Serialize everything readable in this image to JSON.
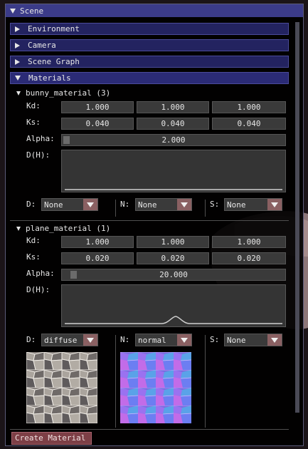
{
  "window": {
    "title": "Scene"
  },
  "sections": [
    {
      "label": "Environment",
      "open": false
    },
    {
      "label": "Camera",
      "open": false
    },
    {
      "label": "Scene Graph",
      "open": false
    },
    {
      "label": "Materials",
      "open": true
    }
  ],
  "materials": [
    {
      "name": "bunny_material (3)",
      "kd_label": "Kd:",
      "kd": [
        "1.000",
        "1.000",
        "1.000"
      ],
      "ks_label": "Ks:",
      "ks": [
        "0.040",
        "0.040",
        "0.040"
      ],
      "alpha_label": "Alpha:",
      "alpha": "2.000",
      "dh_label": "D(H):",
      "d_label": "D:",
      "d_value": "None",
      "n_label": "N:",
      "n_value": "None",
      "s_label": "S:",
      "s_value": "None"
    },
    {
      "name": "plane_material (1)",
      "kd_label": "Kd:",
      "kd": [
        "1.000",
        "1.000",
        "1.000"
      ],
      "ks_label": "Ks:",
      "ks": [
        "0.020",
        "0.020",
        "0.020"
      ],
      "alpha_label": "Alpha:",
      "alpha": "20.000",
      "dh_label": "D(H):",
      "d_label": "D:",
      "d_value": "diffuse",
      "n_label": "N:",
      "n_value": "normal",
      "s_label": "S:",
      "s_value": "None"
    }
  ],
  "create_button": "Create Material",
  "colors": {
    "title_bar": "#3b3b89",
    "header": "#232360",
    "header_open": "#2b2b76",
    "combo_button": "#8a6062",
    "create_button": "#7d3f46",
    "field": "#3a3a3a"
  },
  "icons": {
    "collapse": "triangle-down-icon",
    "expand": "triangle-right-icon",
    "dropdown": "dropdown-arrow-icon"
  }
}
